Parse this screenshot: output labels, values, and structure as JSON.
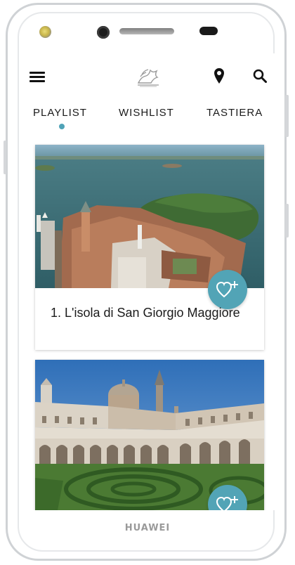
{
  "device": {
    "brand": "HUAWEI"
  },
  "header": {
    "menu_icon": "hamburger-menu-icon",
    "logo_icon": "lion-of-venice-logo-icon",
    "map_icon": "location-pin-icon",
    "search_icon": "search-icon"
  },
  "tabs": [
    {
      "label": "PLAYLIST",
      "active": true
    },
    {
      "label": "WISHLIST",
      "active": false
    },
    {
      "label": "TASTIERA",
      "active": false
    }
  ],
  "colors": {
    "accent": "#52a4b6",
    "text": "#1b1b1b"
  },
  "cards": [
    {
      "title": "1. L'isola di San Giorgio Maggiore",
      "image": "aerial-island-san-giorgio-photo",
      "action_icon": "heart-plus-icon"
    },
    {
      "title": "",
      "image": "cloister-garden-labyrinth-photo",
      "action_icon": "heart-plus-icon"
    }
  ]
}
